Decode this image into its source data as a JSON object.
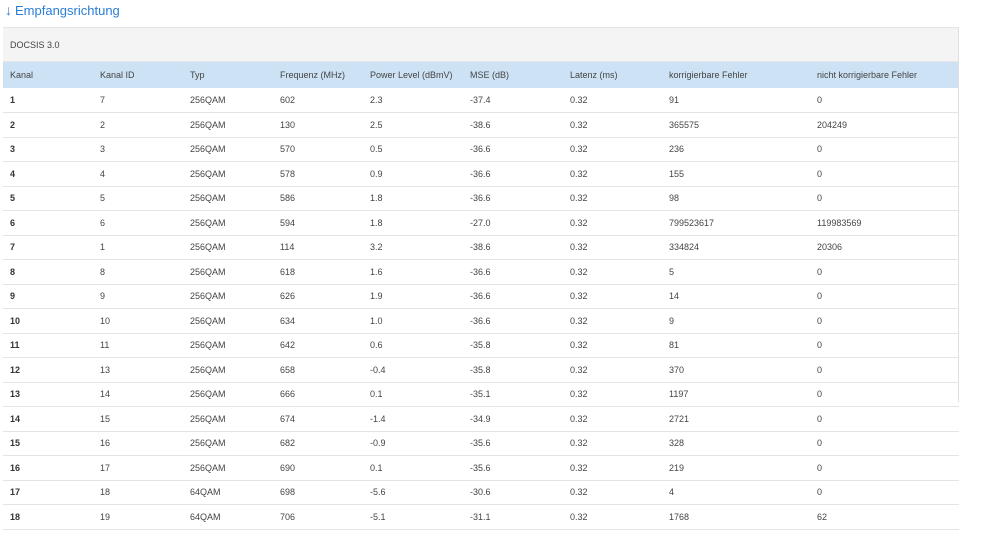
{
  "heading": {
    "arrow": "↓",
    "label": "Empfangsrichtung"
  },
  "section": {
    "title": "DOCSIS 3.0"
  },
  "table": {
    "columns": [
      "Kanal",
      "Kanal ID",
      "Typ",
      "Frequenz (MHz)",
      "Power Level (dBmV)",
      "MSE (dB)",
      "Latenz (ms)",
      "korrigierbare Fehler",
      "nicht korrigierbare Fehler"
    ],
    "rows": [
      [
        "1",
        "7",
        "256QAM",
        "602",
        "2.3",
        "-37.4",
        "0.32",
        "91",
        "0"
      ],
      [
        "2",
        "2",
        "256QAM",
        "130",
        "2.5",
        "-38.6",
        "0.32",
        "365575",
        "204249"
      ],
      [
        "3",
        "3",
        "256QAM",
        "570",
        "0.5",
        "-36.6",
        "0.32",
        "236",
        "0"
      ],
      [
        "4",
        "4",
        "256QAM",
        "578",
        "0.9",
        "-36.6",
        "0.32",
        "155",
        "0"
      ],
      [
        "5",
        "5",
        "256QAM",
        "586",
        "1.8",
        "-36.6",
        "0.32",
        "98",
        "0"
      ],
      [
        "6",
        "6",
        "256QAM",
        "594",
        "1.8",
        "-27.0",
        "0.32",
        "799523617",
        "119983569"
      ],
      [
        "7",
        "1",
        "256QAM",
        "114",
        "3.2",
        "-38.6",
        "0.32",
        "334824",
        "20306"
      ],
      [
        "8",
        "8",
        "256QAM",
        "618",
        "1.6",
        "-36.6",
        "0.32",
        "5",
        "0"
      ],
      [
        "9",
        "9",
        "256QAM",
        "626",
        "1.9",
        "-36.6",
        "0.32",
        "14",
        "0"
      ],
      [
        "10",
        "10",
        "256QAM",
        "634",
        "1.0",
        "-36.6",
        "0.32",
        "9",
        "0"
      ],
      [
        "11",
        "11",
        "256QAM",
        "642",
        "0.6",
        "-35.8",
        "0.32",
        "81",
        "0"
      ],
      [
        "12",
        "13",
        "256QAM",
        "658",
        "-0.4",
        "-35.8",
        "0.32",
        "370",
        "0"
      ],
      [
        "13",
        "14",
        "256QAM",
        "666",
        "0.1",
        "-35.1",
        "0.32",
        "1197",
        "0"
      ],
      [
        "14",
        "15",
        "256QAM",
        "674",
        "-1.4",
        "-34.9",
        "0.32",
        "2721",
        "0"
      ],
      [
        "15",
        "16",
        "256QAM",
        "682",
        "-0.9",
        "-35.6",
        "0.32",
        "328",
        "0"
      ],
      [
        "16",
        "17",
        "256QAM",
        "690",
        "0.1",
        "-35.6",
        "0.32",
        "219",
        "0"
      ],
      [
        "17",
        "18",
        "64QAM",
        "698",
        "-5.6",
        "-30.6",
        "0.32",
        "4",
        "0"
      ],
      [
        "18",
        "19",
        "64QAM",
        "706",
        "-5.1",
        "-31.1",
        "0.32",
        "1768",
        "62"
      ]
    ]
  },
  "colors": {
    "link": "#2a7ed4",
    "header_row": "#cde3f5",
    "section_bg": "#f4f4f4"
  }
}
